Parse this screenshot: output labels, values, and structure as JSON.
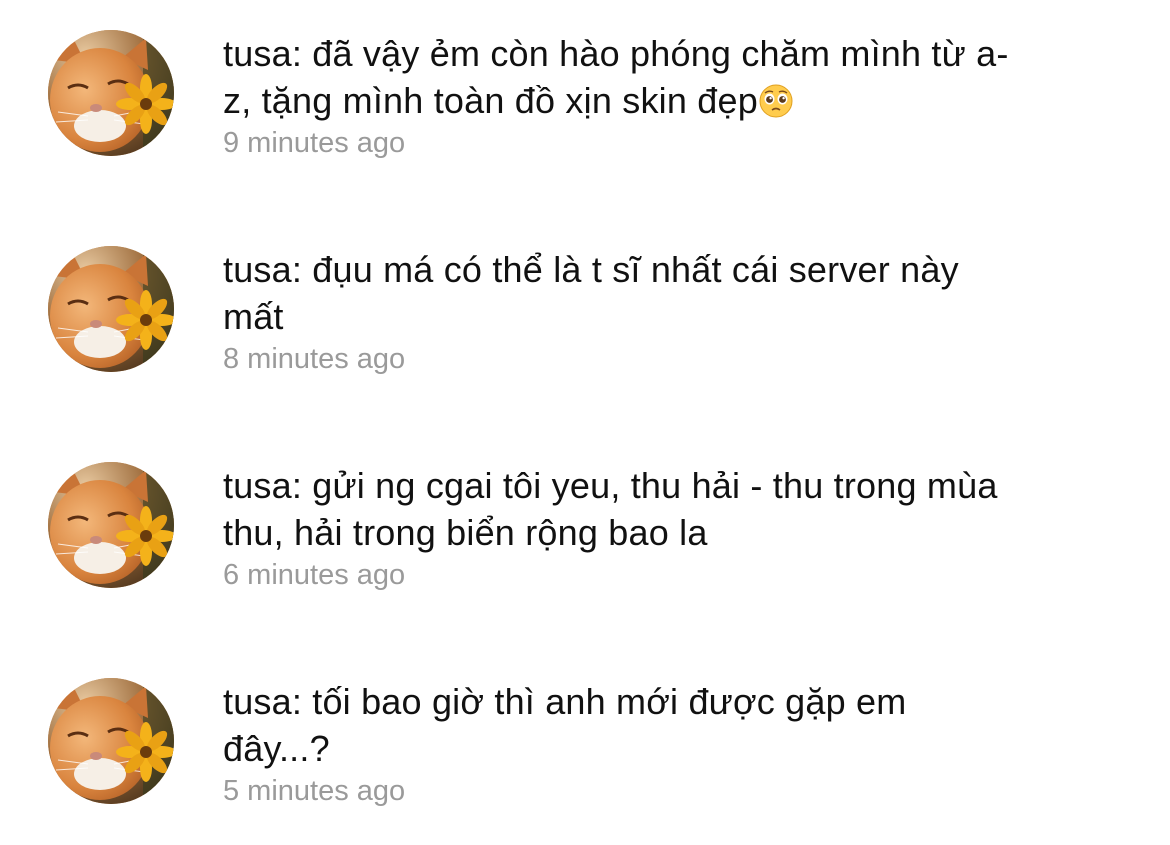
{
  "comments": [
    {
      "author": "tusa",
      "text": "tusa: đã vậy ẻm còn hào phóng chăm mình từ a-\nz, tặng mình toàn đồ xịn skin đẹp",
      "emoji": "pleading-face",
      "time": "9 minutes ago"
    },
    {
      "author": "tusa",
      "text": "tusa: đụu má có thể là t sĩ nhất cái server này\nmất",
      "time": "8 minutes ago"
    },
    {
      "author": "tusa",
      "text": "tusa: gửi ng cgai tôi yeu, thu hải - thu trong mùa\nthu, hải trong biển rộng bao la",
      "time": "6 minutes ago"
    },
    {
      "author": "tusa",
      "text": "tusa: tối bao giờ thì anh mới được gặp em\nđây...?",
      "time": "5 minutes ago"
    }
  ],
  "icons": {
    "avatar": "orange-cat-with-yellow-flower-avatar",
    "emoji": "pleading-face-emoji"
  },
  "colors": {
    "text": "#111111",
    "timestamp": "#9a9a9a",
    "background": "#ffffff"
  }
}
